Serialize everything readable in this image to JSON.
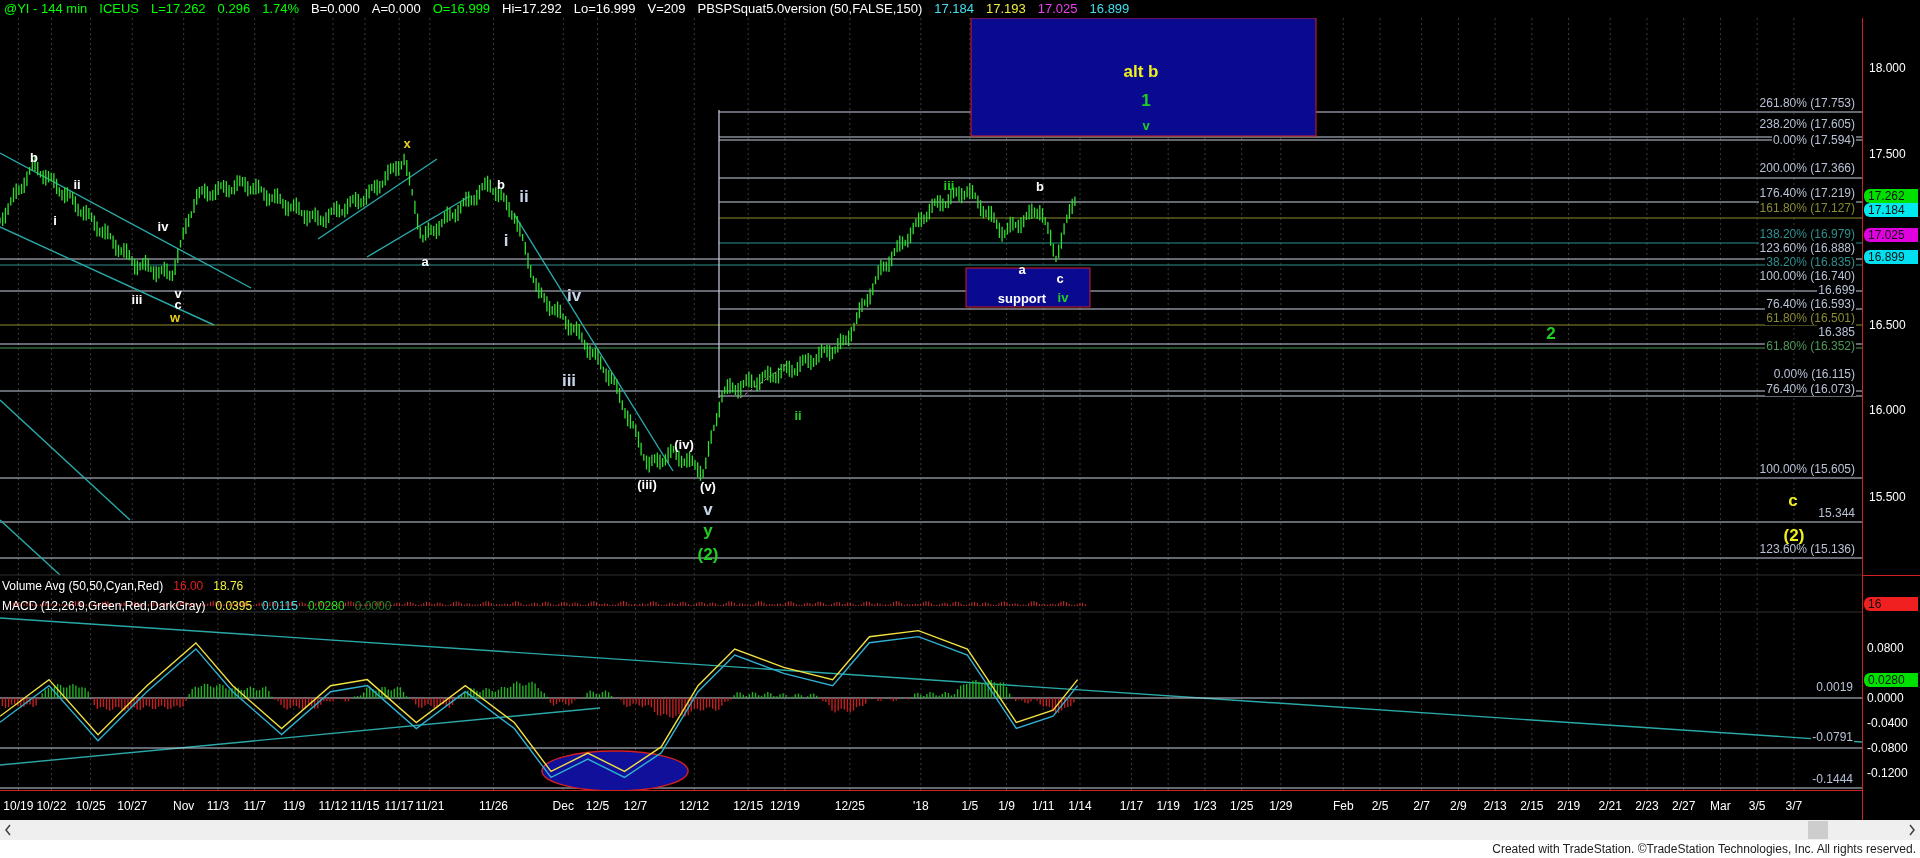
{
  "header": [
    {
      "text": "@YI - 144 min",
      "color": "#00ff00"
    },
    {
      "text": "ICEUS",
      "color": "#00ff00"
    },
    {
      "text": "L=17.262",
      "color": "#00ff00"
    },
    {
      "text": "0.296",
      "color": "#00ff00"
    },
    {
      "text": "1.74%",
      "color": "#00ff00"
    },
    {
      "text": "B=0.000",
      "color": "#ffffff"
    },
    {
      "text": "A=0.000",
      "color": "#ffffff"
    },
    {
      "text": "O=16.999",
      "color": "#00ff00"
    },
    {
      "text": "Hi=17.292",
      "color": "#ffffff"
    },
    {
      "text": "Lo=16.999",
      "color": "#ffffff"
    },
    {
      "text": "V=209",
      "color": "#ffffff"
    },
    {
      "text": "PBSPSquat5.0version (50,FALSE,150)",
      "color": "#ffffff"
    },
    {
      "text": "17.184",
      "color": "#40e0f0"
    },
    {
      "text": "17.193",
      "color": "#f0f040"
    },
    {
      "text": "17.025",
      "color": "#f040f0"
    },
    {
      "text": "16.899",
      "color": "#40e0f0"
    }
  ],
  "fib_levels": [
    {
      "label": "261.80% (17.753)",
      "color": "#b8c2d6"
    },
    {
      "label": "238.20% (17.605)",
      "color": "#b8c2d6"
    },
    {
      "label": "0.00% (17.594)",
      "color": "#b8c2d6"
    },
    {
      "label": "200.00% (17.366)",
      "color": "#b8c2d6"
    },
    {
      "label": "176.40% (17.219)",
      "color": "#b8c2d6"
    },
    {
      "label": "161.80% (17.127)",
      "color": "#8c8c32"
    },
    {
      "label": "138.20% (16.979)",
      "color": "#2f8f8f"
    },
    {
      "label": "123.60% (16.888)",
      "color": "#b8c2d6"
    },
    {
      "label": "38.20% (16.835)",
      "color": "#2f8f8f"
    },
    {
      "label": "100.00% (16.740)",
      "color": "#b8c2d6"
    },
    {
      "label": "16.699",
      "color": "#b8c2d6"
    },
    {
      "label": "76.40% (16.593)",
      "color": "#b8c2d6"
    },
    {
      "label": "61.80% (16.501)",
      "color": "#8c8c32"
    },
    {
      "label": "16.385",
      "color": "#b8c2d6"
    },
    {
      "label": "61.80% (16.352)",
      "color": "#4f9a5a"
    },
    {
      "label": "0.00% (16.115)",
      "color": "#b8c2d6"
    },
    {
      "label": "76.40% (16.073)",
      "color": "#b8c2d6"
    },
    {
      "label": "100.00% (15.605)",
      "color": "#b8c2d6"
    },
    {
      "label": "15.344",
      "color": "#b8c2d6"
    },
    {
      "label": "123.60% (15.136)",
      "color": "#b8c2d6"
    }
  ],
  "wave_labels": [
    {
      "text": "b",
      "color": "#ffffff",
      "kind": "minor"
    },
    {
      "text": "ii",
      "color": "#ffffff",
      "kind": "minor"
    },
    {
      "text": "i",
      "color": "#ffffff",
      "kind": "minor"
    },
    {
      "text": "iii",
      "color": "#ffffff",
      "kind": "minor"
    },
    {
      "text": "iv",
      "color": "#ffffff",
      "kind": "minor"
    },
    {
      "text": "v",
      "color": "#ffffff",
      "kind": "minor"
    },
    {
      "text": "c",
      "color": "#ffffff",
      "kind": "minor"
    },
    {
      "text": "w",
      "color": "#e8d020",
      "kind": "minor"
    },
    {
      "text": "x",
      "color": "#e8d020",
      "kind": "minor"
    },
    {
      "text": "a",
      "color": "#ffffff",
      "kind": "minor"
    },
    {
      "text": "b",
      "color": "#ffffff",
      "kind": "minor"
    },
    {
      "text": "ii",
      "color": "#c8d4e8",
      "kind": "major"
    },
    {
      "text": "i",
      "color": "#c8d4e8",
      "kind": "major"
    },
    {
      "text": "iv",
      "color": "#c8d4e8",
      "kind": "major"
    },
    {
      "text": "iii",
      "color": "#c8d4e8",
      "kind": "major"
    },
    {
      "text": "(iv)",
      "color": "#ffffff",
      "kind": "minor"
    },
    {
      "text": "(iii)",
      "color": "#ffffff",
      "kind": "minor"
    },
    {
      "text": "(v)",
      "color": "#ffffff",
      "kind": "minor"
    },
    {
      "text": "v",
      "color": "#c8d4e8",
      "kind": "major"
    },
    {
      "text": "y",
      "color": "#20d020",
      "kind": "major"
    },
    {
      "text": "(2)",
      "color": "#20d020",
      "kind": "major"
    },
    {
      "text": "ii",
      "color": "#20d020",
      "kind": "minor"
    },
    {
      "text": "iii",
      "color": "#20d020",
      "kind": "minor"
    },
    {
      "text": "b",
      "color": "#ffffff",
      "kind": "minor"
    },
    {
      "text": "a",
      "color": "#ffffff",
      "kind": "minor"
    },
    {
      "text": "c",
      "color": "#ffffff",
      "kind": "minor"
    },
    {
      "text": "support",
      "color": "#ffffff",
      "kind": "minor"
    },
    {
      "text": "iv",
      "color": "#20d020",
      "kind": "minor"
    },
    {
      "text": "alt b",
      "color": "#f0f020",
      "kind": "major"
    },
    {
      "text": "1",
      "color": "#20d020",
      "kind": "major"
    },
    {
      "text": "v",
      "color": "#20d020",
      "kind": "minor"
    },
    {
      "text": "2",
      "color": "#20d020",
      "kind": "major"
    },
    {
      "text": "c",
      "color": "#f0f020",
      "kind": "major"
    },
    {
      "text": "(2)",
      "color": "#f0f020",
      "kind": "major"
    }
  ],
  "volume_legend": [
    {
      "text": "Volume Avg (50,50,Cyan,Red)",
      "color": "#ffffff"
    },
    {
      "text": "16.00",
      "color": "#e02020"
    },
    {
      "text": "18.76",
      "color": "#f0f040"
    }
  ],
  "macd_legend": [
    {
      "text": "MACD (12,26,9,Green,Red,DarkGray)",
      "color": "#ffffff"
    },
    {
      "text": "0.0395",
      "color": "#f0f040"
    },
    {
      "text": "0.0115",
      "color": "#40e0f0"
    },
    {
      "text": "0.0280",
      "color": "#20e020"
    },
    {
      "text": "0.0000",
      "color": "#208020"
    }
  ],
  "macd_levels": [
    "0.0019",
    "-0.0791",
    "-0.1444"
  ],
  "price_axis": [
    "18.000",
    "17.500",
    "16.500",
    "16.000",
    "15.500"
  ],
  "macd_axis": [
    "0.0800",
    "0.0000",
    "-0.0400",
    "-0.0800",
    "-0.1200"
  ],
  "axis_tags": [
    {
      "text": "17.262",
      "color": "#00e000"
    },
    {
      "text": "17.184",
      "color": "#00e8f0"
    },
    {
      "text": "17.025",
      "color": "#e000e0"
    },
    {
      "text": "16.899",
      "color": "#00e0f0"
    },
    {
      "text": "16",
      "color": "#f02020"
    },
    {
      "text": "0.0280",
      "color": "#00e000"
    }
  ],
  "date_axis": [
    "10/19",
    "10/22",
    "10/25",
    "10/27",
    "Nov",
    "11/3",
    "11/7",
    "11/9",
    "11/12",
    "11/15",
    "11/17",
    "11/21",
    "11/26",
    "Dec",
    "12/5",
    "12/7",
    "12/12",
    "12/15",
    "12/19",
    "12/25",
    "'18",
    "1/5",
    "1/9",
    "1/11",
    "1/14",
    "1/17",
    "1/19",
    "1/23",
    "1/25",
    "1/29",
    "Feb",
    "2/5",
    "2/7",
    "2/9",
    "2/13",
    "2/15",
    "2/19",
    "2/21",
    "2/23",
    "2/27",
    "Mar",
    "3/5",
    "3/7"
  ],
  "footer": "Created with TradeStation. ©TradeStation Technologies, Inc. All rights reserved."
}
